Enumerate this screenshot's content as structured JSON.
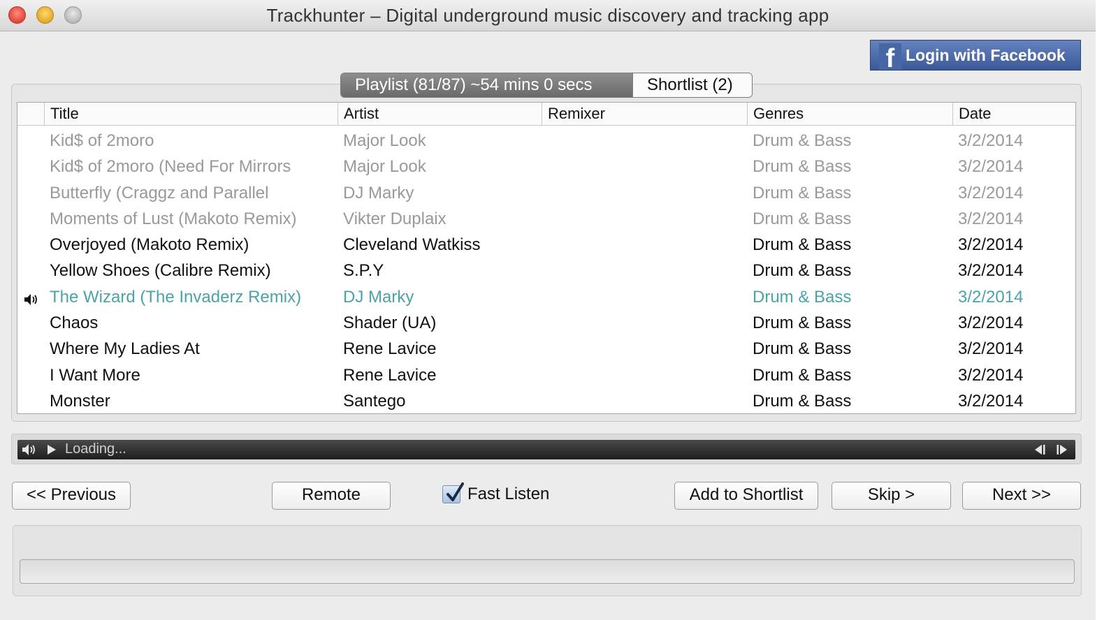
{
  "window": {
    "title": "Trackhunter – Digital underground music discovery and tracking app"
  },
  "facebook": {
    "logo": "f",
    "label": "Login with Facebook"
  },
  "tabs": {
    "playlist_label": "Playlist (81/87)    ~54 mins 0 secs",
    "shortlist_label": "Shortlist (2)"
  },
  "table": {
    "columns": {
      "title": "Title",
      "artist": "Artist",
      "remixer": "Remixer",
      "genres": "Genres",
      "date": "Date"
    },
    "rows": [
      {
        "title": "Kid$ of 2moro",
        "artist": "Major Look",
        "remixer": "",
        "genres": "Drum & Bass",
        "date": "3/2/2014",
        "state": "played"
      },
      {
        "title": "Kid$ of 2moro (Need For Mirrors",
        "artist": "Major Look",
        "remixer": "",
        "genres": "Drum & Bass",
        "date": "3/2/2014",
        "state": "played"
      },
      {
        "title": "Butterfly (Craggz and Parallel",
        "artist": "DJ Marky",
        "remixer": "",
        "genres": "Drum & Bass",
        "date": "3/2/2014",
        "state": "played"
      },
      {
        "title": "Moments of Lust (Makoto Remix)",
        "artist": "Vikter Duplaix",
        "remixer": "",
        "genres": "Drum & Bass",
        "date": "3/2/2014",
        "state": "played"
      },
      {
        "title": "Overjoyed (Makoto Remix)",
        "artist": "Cleveland Watkiss",
        "remixer": "",
        "genres": "Drum & Bass",
        "date": "3/2/2014",
        "state": "normal"
      },
      {
        "title": "Yellow Shoes (Calibre Remix)",
        "artist": "S.P.Y",
        "remixer": "",
        "genres": "Drum & Bass",
        "date": "3/2/2014",
        "state": "normal"
      },
      {
        "title": "The Wizard (The Invaderz Remix)",
        "artist": "DJ Marky",
        "remixer": "",
        "genres": "Drum & Bass",
        "date": "3/2/2014",
        "state": "playing"
      },
      {
        "title": "Chaos",
        "artist": "Shader (UA)",
        "remixer": "",
        "genres": "Drum & Bass",
        "date": "3/2/2014",
        "state": "normal"
      },
      {
        "title": "Where My Ladies At",
        "artist": "Rene Lavice",
        "remixer": "",
        "genres": "Drum & Bass",
        "date": "3/2/2014",
        "state": "normal"
      },
      {
        "title": "I Want More",
        "artist": "Rene Lavice",
        "remixer": "",
        "genres": "Drum & Bass",
        "date": "3/2/2014",
        "state": "normal"
      },
      {
        "title": "Monster",
        "artist": "Santego",
        "remixer": "",
        "genres": "Drum & Bass",
        "date": "3/2/2014",
        "state": "normal"
      }
    ]
  },
  "player": {
    "status": "Loading..."
  },
  "buttons": {
    "previous": "<< Previous",
    "remote": "Remote",
    "add_to_shortlist": "Add to Shortlist",
    "skip": "Skip >",
    "next": "Next >>"
  },
  "fast_listen": {
    "label": "Fast Listen",
    "checked": true
  },
  "colors": {
    "playing": "#4aa3a8",
    "played": "#999999",
    "facebook": "#3b5998"
  },
  "icons": [
    "speaker-icon",
    "play-icon",
    "skip-back-icon",
    "skip-forward-icon",
    "facebook-logo-icon",
    "checkmark-icon"
  ]
}
